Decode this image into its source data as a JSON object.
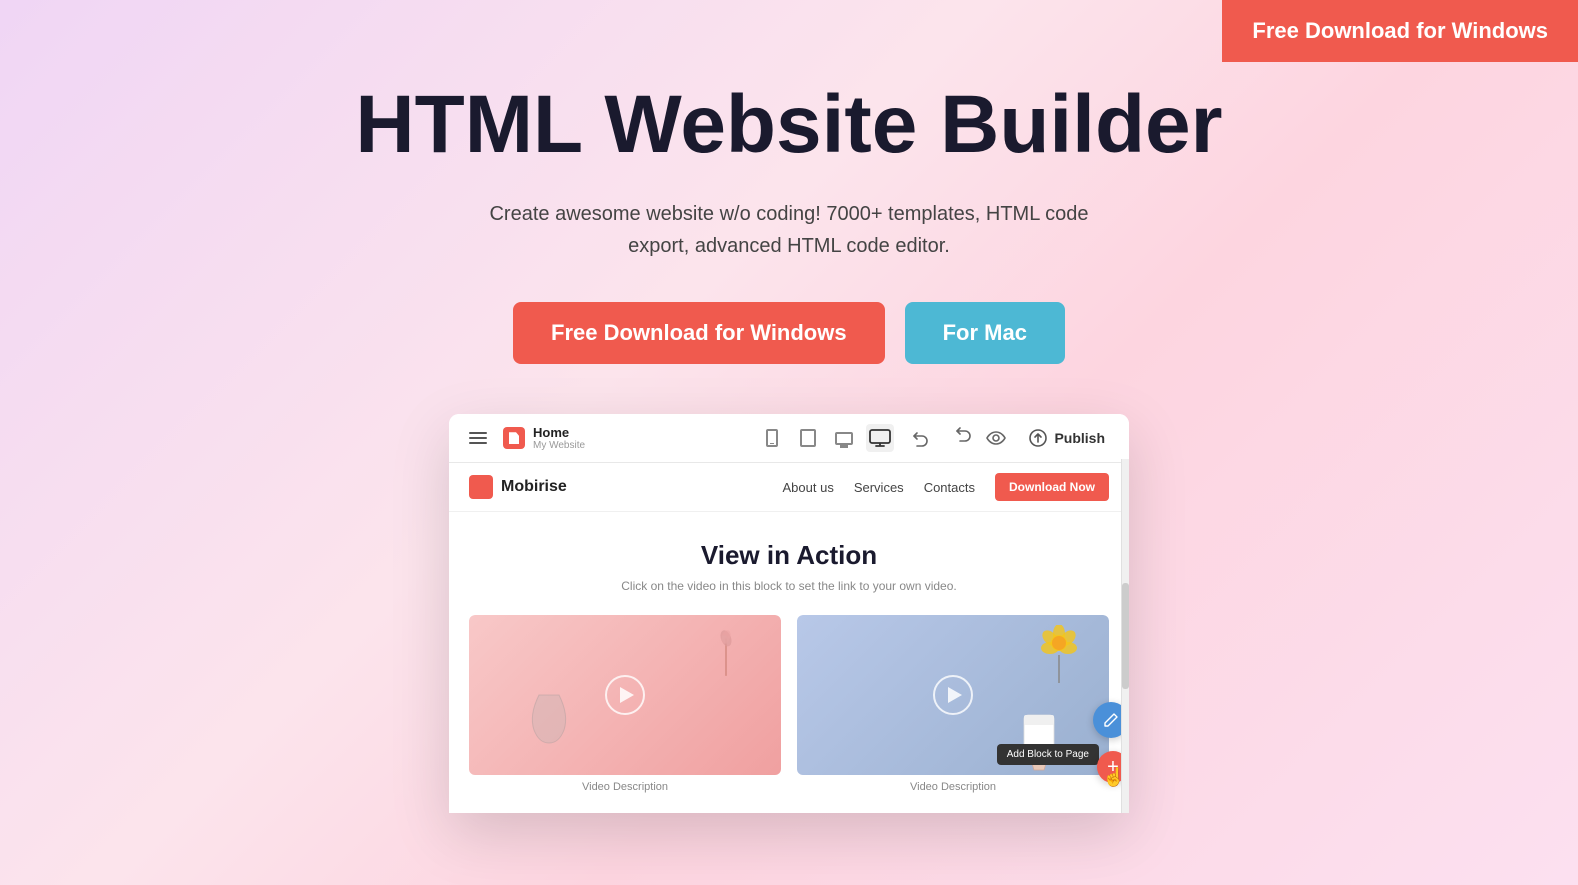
{
  "topCta": {
    "label": "Free Download for Windows"
  },
  "hero": {
    "title": "HTML Website Builder",
    "subtitle": "Create awesome website w/o coding! 7000+ templates, HTML code export, advanced HTML code editor.",
    "btnWindows": "Free Download for Windows",
    "btnMac": "For Mac"
  },
  "appPreview": {
    "toolbar": {
      "pageName": "Home",
      "pageSite": "My Website",
      "deviceButtons": [
        {
          "id": "mobile",
          "label": "Mobile"
        },
        {
          "id": "tablet",
          "label": "Tablet"
        },
        {
          "id": "laptop",
          "label": "Laptop"
        },
        {
          "id": "desktop",
          "label": "Desktop",
          "active": true
        }
      ],
      "undoLabel": "↩",
      "redoLabel": "↩",
      "previewLabel": "👁",
      "publishLabel": "Publish"
    },
    "navbar": {
      "brandName": "Mobirise",
      "links": [
        "About us",
        "Services",
        "Contacts"
      ],
      "downloadBtn": "Download Now"
    },
    "content": {
      "heading": "View in Action",
      "subtext": "Click on the video in this block to set the link to your own video.",
      "videos": [
        {
          "desc": "Video Description"
        },
        {
          "desc": "Video Description"
        }
      ],
      "addBlockTooltip": "Add Block to Page",
      "addBlockBtn": "+"
    }
  }
}
